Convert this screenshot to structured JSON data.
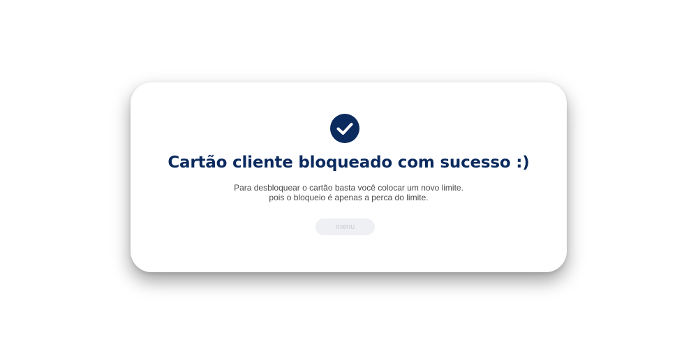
{
  "dialog": {
    "title": "Cartão cliente bloqueado com sucesso :)",
    "message_line_1": "Para desbloquear o cartão basta você colocar um novo limite.",
    "message_line_2": "pois o bloqueio é apenas a perca do limite.",
    "menu_label": "menu",
    "icon": "check-icon"
  },
  "colors": {
    "accent": "#0b2a5e",
    "text_body": "#4a4a4a",
    "button_bg": "#eef0f3",
    "button_text": "#c9ccd2"
  }
}
